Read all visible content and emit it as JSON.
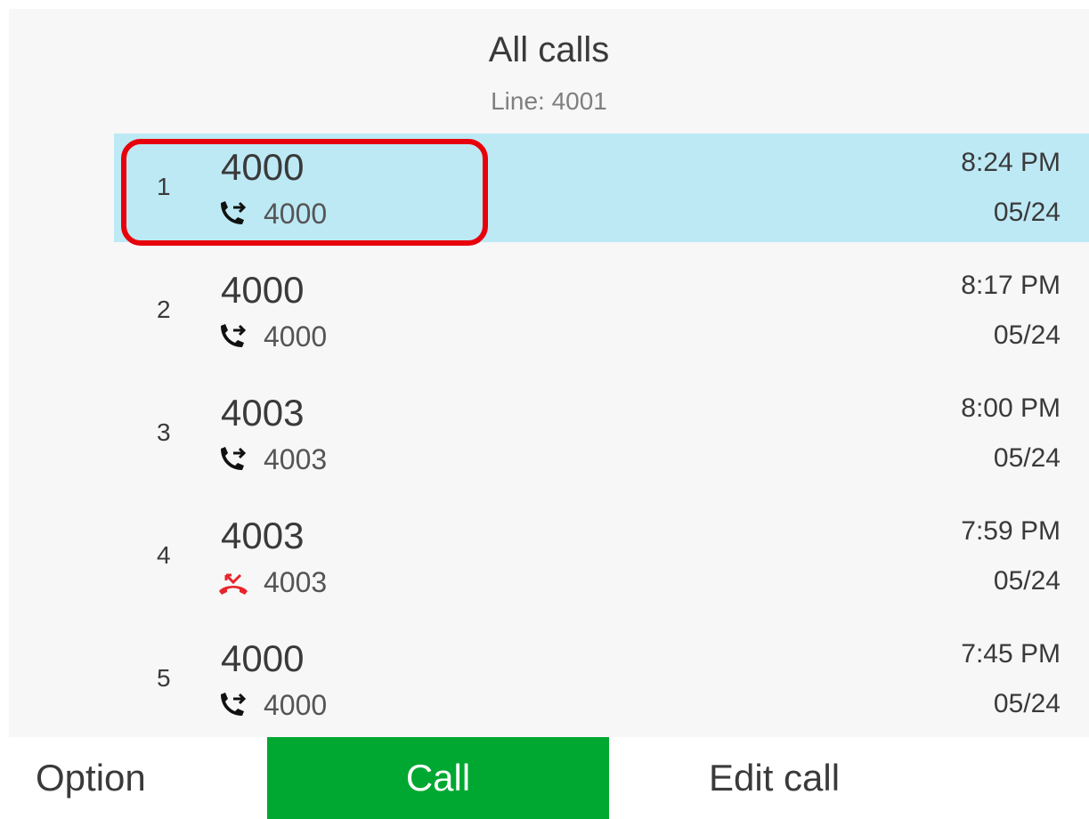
{
  "header": {
    "title": "All calls",
    "subtitle": "Line: 4001"
  },
  "calls": [
    {
      "index": "1",
      "name": "4000",
      "number": "4000",
      "icon": "outgoing-call-icon",
      "time": "8:24 PM",
      "date": "05/24",
      "selected": true
    },
    {
      "index": "2",
      "name": "4000",
      "number": "4000",
      "icon": "outgoing-call-icon",
      "time": "8:17 PM",
      "date": "05/24"
    },
    {
      "index": "3",
      "name": "4003",
      "number": "4003",
      "icon": "outgoing-call-icon",
      "time": "8:00 PM",
      "date": "05/24"
    },
    {
      "index": "4",
      "name": "4003",
      "number": "4003",
      "icon": "missed-call-icon",
      "time": "7:59 PM",
      "date": "05/24"
    },
    {
      "index": "5",
      "name": "4000",
      "number": "4000",
      "icon": "outgoing-call-icon",
      "time": "7:45 PM",
      "date": "05/24"
    }
  ],
  "softkeys": {
    "option": "Option",
    "call": "Call",
    "edit_call": "Edit call"
  },
  "colors": {
    "selected_row": "#bde9f5",
    "call_button": "#00a831",
    "highlight_outline": "#e8000b",
    "missed_icon": "#e8242b"
  }
}
